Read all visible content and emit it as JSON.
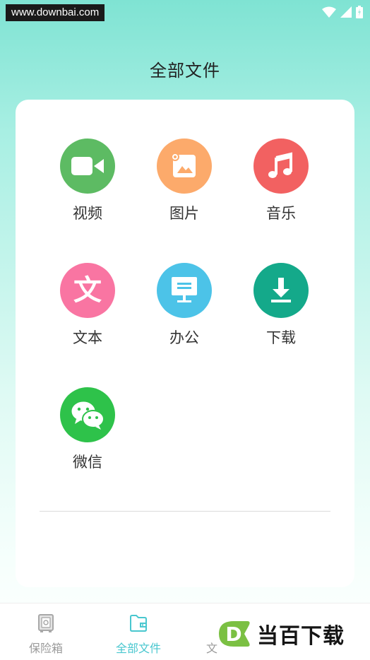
{
  "status_bar": {
    "watermark": "www.downbai.com"
  },
  "header": {
    "title": "全部文件"
  },
  "categories": [
    {
      "label": "视频",
      "icon": "video-camera-icon",
      "color": "#5dbb63"
    },
    {
      "label": "图片",
      "icon": "image-icon",
      "color": "#fcaa6b"
    },
    {
      "label": "音乐",
      "icon": "music-note-icon",
      "color": "#f26161"
    },
    {
      "label": "文本",
      "icon": "text-document-icon",
      "color": "#f975a2"
    },
    {
      "label": "办公",
      "icon": "monitor-icon",
      "color": "#4cc3e8"
    },
    {
      "label": "下载",
      "icon": "download-icon",
      "color": "#14a98a"
    },
    {
      "label": "微信",
      "icon": "wechat-icon",
      "color": "#2ec24a"
    }
  ],
  "text_glyph": "文",
  "tab_bar": {
    "tabs": [
      {
        "label": "保险箱",
        "icon": "safe-icon"
      },
      {
        "label": "全部文件",
        "icon": "folder-icon",
        "active": true
      },
      {
        "label": "文",
        "icon": "document-icon"
      }
    ],
    "active_color": "#49c7cf"
  },
  "brand": {
    "logo_letter": "D",
    "name": "当百下载"
  }
}
